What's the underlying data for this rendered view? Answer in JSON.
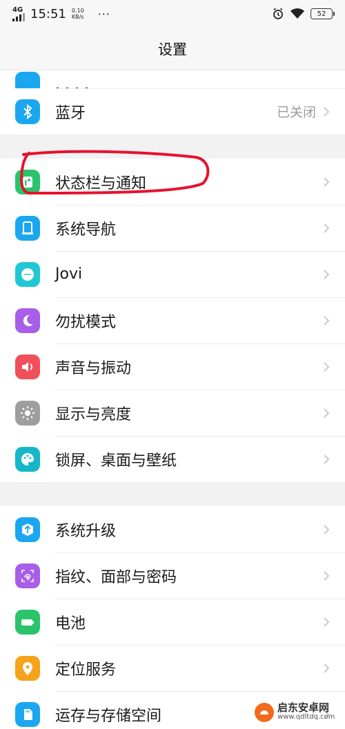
{
  "status_bar": {
    "network": "4G",
    "time": "15:51",
    "speed_value": "0.10",
    "speed_unit": "KB/s",
    "more": "···",
    "battery": "52"
  },
  "header": {
    "title": "设置"
  },
  "settings": {
    "partial_item": {
      "icon": "hotspot-icon",
      "color": "#1aa7f0"
    },
    "bluetooth": {
      "label": "蓝牙",
      "value": "已关闭",
      "icon": "bluetooth-icon",
      "color": "#1aa7f0"
    },
    "status_bar_notifications": {
      "label": "状态栏与通知",
      "icon": "status-bar-icon",
      "color": "#2bc46b"
    },
    "system_navigation": {
      "label": "系统导航",
      "icon": "navigation-icon",
      "color": "#1aa7f0"
    },
    "jovi": {
      "label": "Jovi",
      "icon": "jovi-icon",
      "color": "#22c7d4"
    },
    "do_not_disturb": {
      "label": "勿扰模式",
      "icon": "moon-icon",
      "color": "#a75ee8"
    },
    "sound_vibration": {
      "label": "声音与振动",
      "icon": "speaker-icon",
      "color": "#f0505a"
    },
    "display_brightness": {
      "label": "显示与亮度",
      "icon": "brightness-icon",
      "color": "#9e9e9e"
    },
    "lockscreen_wallpaper": {
      "label": "锁屏、桌面与壁纸",
      "icon": "palette-icon",
      "color": "#16b7c9"
    },
    "system_upgrade": {
      "label": "系统升级",
      "icon": "upgrade-icon",
      "color": "#1aa7f0"
    },
    "fingerprint_face_password": {
      "label": "指纹、面部与密码",
      "icon": "fingerprint-icon",
      "color": "#a75ee8"
    },
    "battery": {
      "label": "电池",
      "icon": "battery-icon",
      "color": "#2bc46b"
    },
    "location_services": {
      "label": "定位服务",
      "icon": "location-icon",
      "color": "#f5a31a"
    },
    "storage": {
      "label": "运存与存储空间",
      "icon": "storage-icon",
      "color": "#1aa7f0"
    }
  },
  "annotation": {
    "color": "#e8112d"
  },
  "watermark": {
    "main": "启东安卓网",
    "sub": "www.qdltdq.com"
  }
}
